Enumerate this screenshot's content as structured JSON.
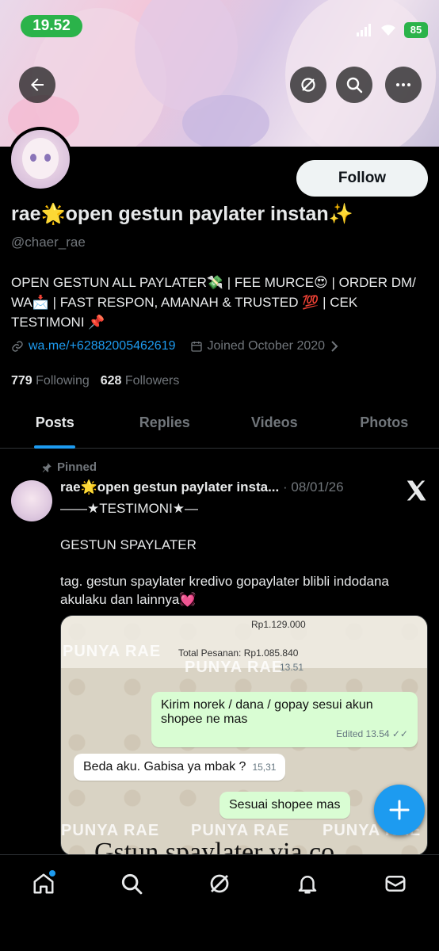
{
  "status_bar": {
    "time": "19.52",
    "battery": "85"
  },
  "colors": {
    "accent": "#1d9bf0",
    "status_green": "#2bb34a",
    "background": "#000000"
  },
  "header": {
    "back_icon": "arrow-left-icon",
    "grok_icon": "grok-icon",
    "search_icon": "search-icon",
    "more_icon": "more-horizontal-icon"
  },
  "profile": {
    "name": "rae🌟open gestun paylater instan✨",
    "handle": "@chaer_rae",
    "follow_label": "Follow",
    "bio": "OPEN GESTUN ALL PAYLATER💸 | FEE MURCE😍 | ORDER DM/ WA📩 | FAST RESPON, AMANAH & TRUSTED 💯 | CEK TESTIMONI 📌",
    "link": "wa.me/+62882005462619",
    "joined": "Joined October 2020",
    "following_count": "779",
    "following_label": "Following",
    "followers_count": "628",
    "followers_label": "Followers"
  },
  "tabs": [
    {
      "label": "Posts"
    },
    {
      "label": "Replies"
    },
    {
      "label": "Videos"
    },
    {
      "label": "Photos"
    }
  ],
  "post": {
    "pinned_label": "Pinned",
    "author": "rae🌟open gestun paylater insta...",
    "date": "· 08/01/26",
    "line1": "——★TESTIMONI★—",
    "line2": "GESTUN SPAYLATER",
    "line3": "tag. gestun spaylater kredivo gopaylater blibli indodana akulaku dan lainnya💓"
  },
  "media": {
    "price1": "Rp1.129.000",
    "total_label": "Total Pesanan: Rp1.085.840",
    "time1": "13.51",
    "msg_out1": "Kirim norek / dana / gopay sesui akun shopee ne mas",
    "msg_out1_meta": "Edited 13.54 ✓✓",
    "msg_in1": "Beda aku. Gabisa ya mbak ?",
    "msg_in1_time": "15,31",
    "msg_out2": "Sesuai shopee mas",
    "watermark": "PUNYA RAE",
    "caption": "Gstun spaylater via co"
  },
  "bottom_nav": [
    {
      "icon": "home-icon"
    },
    {
      "icon": "search-icon"
    },
    {
      "icon": "grok-icon"
    },
    {
      "icon": "bell-icon"
    },
    {
      "icon": "mail-icon"
    }
  ]
}
